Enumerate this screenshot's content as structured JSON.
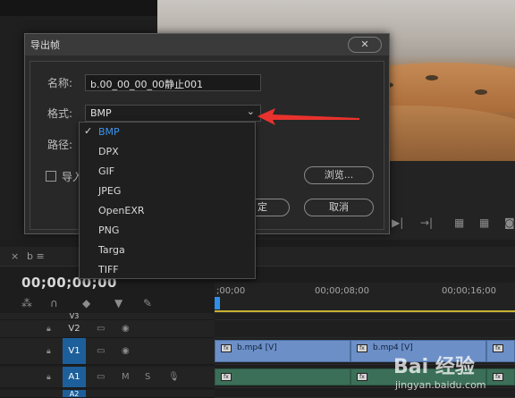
{
  "dialog": {
    "title": "导出帧",
    "close_symbol": "✕",
    "name_label": "名称:",
    "name_value": "b.00_00_00_00静止001",
    "format_label": "格式:",
    "format_value": "BMP",
    "path_label": "路径:",
    "import_label": "导入",
    "browse_label": "浏览...",
    "ok_label": "定",
    "cancel_label": "取消"
  },
  "format_options": [
    {
      "label": "BMP",
      "selected": true
    },
    {
      "label": "DPX",
      "selected": false
    },
    {
      "label": "GIF",
      "selected": false
    },
    {
      "label": "JPEG",
      "selected": false
    },
    {
      "label": "OpenEXR",
      "selected": false
    },
    {
      "label": "PNG",
      "selected": false
    },
    {
      "label": "Targa",
      "selected": false
    },
    {
      "label": "TIFF",
      "selected": false
    }
  ],
  "timeline": {
    "tab_close": "×",
    "tab_name": "b",
    "tab_menu": "≡",
    "timecode": "00;00;00;00",
    "ruler_ticks": [
      ";00;00",
      "00;00;08;00",
      "00;00;16;00"
    ],
    "tracks": [
      {
        "name": "V3"
      },
      {
        "name": "V2"
      },
      {
        "name": "V1"
      },
      {
        "name": "A1"
      },
      {
        "name": "A2"
      }
    ],
    "clip_label": "b.mp4 [V]",
    "track_m": "M",
    "track_s": "S"
  },
  "watermark": {
    "brand": "Bai 经验",
    "url": "jingyan.baidu.com"
  },
  "colors": {
    "accent_blue": "#3d94ec",
    "arrow_red": "#e8322d",
    "clip_video": "#6c8fc7",
    "clip_audio": "#3c6f58"
  }
}
